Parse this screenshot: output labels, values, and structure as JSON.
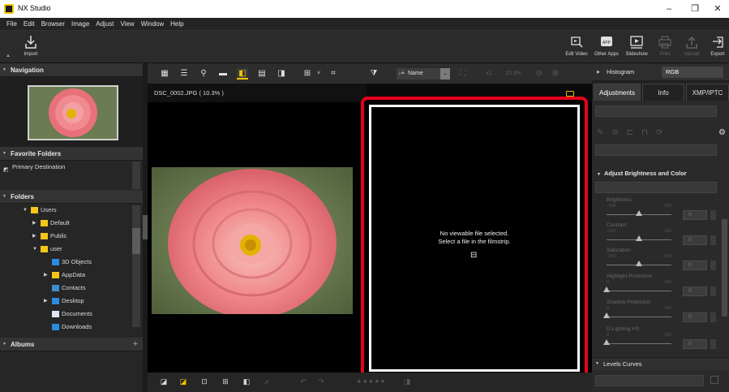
{
  "window": {
    "title": "NX Studio",
    "minimize": "–",
    "maximize": "❐",
    "close": "✕"
  },
  "menu": [
    "File",
    "Edit",
    "Browser",
    "Image",
    "Adjust",
    "View",
    "Window",
    "Help"
  ],
  "toolbar": {
    "import_label": "Import",
    "edit_video_label": "Edit Video",
    "other_apps_label": "Other Apps",
    "slideshow_label": "Slideshow",
    "print_label": "Print",
    "upload_label": "Upload",
    "export_label": "Export"
  },
  "left": {
    "navigation_title": "Navigation",
    "favorites_title": "Favorite Folders",
    "favorites": [
      "Primary Destination"
    ],
    "folders_title": "Folders",
    "folders": [
      {
        "label": "Users",
        "expanded": true
      },
      {
        "label": "Default",
        "expanded": false
      },
      {
        "label": "Public",
        "expanded": false
      },
      {
        "label": "user",
        "expanded": true
      },
      {
        "label": "3D Objects"
      },
      {
        "label": "AppData",
        "expanded": false
      },
      {
        "label": "Contacts"
      },
      {
        "label": "Desktop",
        "expanded": false
      },
      {
        "label": "Documents"
      },
      {
        "label": "Downloads"
      }
    ],
    "albums_title": "Albums",
    "albums_add": "+"
  },
  "view_toolbar": {
    "sort_label": "Name",
    "sort_prefix": "↓≟",
    "zoom_1x": "x1",
    "zoom_percent": "10.3%"
  },
  "viewer": {
    "image_caption": "DSC_0002.JPG ( 10.3% )",
    "no_file_line1": "No viewable file selected.",
    "no_file_line2": "Select a file in the filmstrip."
  },
  "right": {
    "histogram_label": "Histogram",
    "histogram_channel": "RGB",
    "tabs": [
      "Adjustments",
      "Info",
      "XMP/IPTC"
    ],
    "section_brightness": "Adjust Brightness and Color",
    "sliders": [
      {
        "label": "Brightness",
        "min": "-100",
        "max": "100",
        "value": "0"
      },
      {
        "label": "Contrast",
        "min": "-100",
        "max": "100",
        "value": "0"
      },
      {
        "label": "Saturation",
        "min": "-100",
        "max": "100",
        "value": "0"
      },
      {
        "label": "Highlight Protection",
        "min": "0",
        "max": "100",
        "value": "0"
      },
      {
        "label": "Shadow Protection",
        "min": "0",
        "max": "100",
        "value": "0"
      },
      {
        "label": "D-Lighting HS",
        "min": "0",
        "max": "100",
        "value": "0"
      }
    ],
    "section_levels": "Levels  Curves"
  },
  "colors": {
    "accent_yellow": "#f2c400",
    "highlight_red": "#e8001b",
    "folder_yellow": "#f5c518",
    "folder_blue": "#2a8be0"
  }
}
